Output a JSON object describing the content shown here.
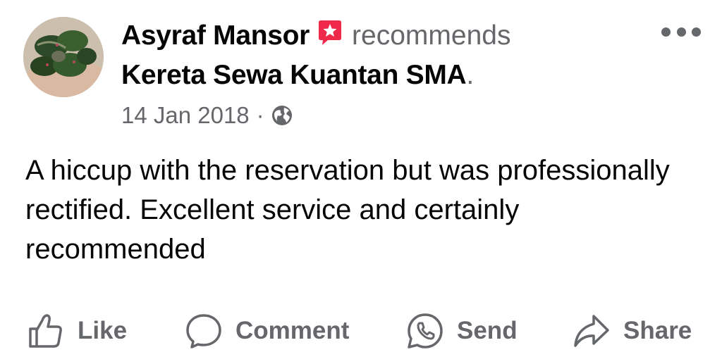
{
  "post": {
    "author": "Asyraf Mansor",
    "verb": "recommends",
    "page_name": "Kereta Sewa Kuantan SMA",
    "period": ".",
    "date": "14 Jan 2018",
    "separator": "·",
    "audience_icon": "globe-icon",
    "recommend_badge_color": "#f02849",
    "text": "A hiccup with the reservation but was professionally rectified. Excellent service and certainly recommended"
  },
  "actions": [
    {
      "label": "Like",
      "icon": "thumbs-up-icon"
    },
    {
      "label": "Comment",
      "icon": "comment-bubble-icon"
    },
    {
      "label": "Send",
      "icon": "whatsapp-icon"
    },
    {
      "label": "Share",
      "icon": "share-arrow-icon"
    }
  ],
  "colors": {
    "text": "#050505",
    "secondary": "#65676b"
  }
}
